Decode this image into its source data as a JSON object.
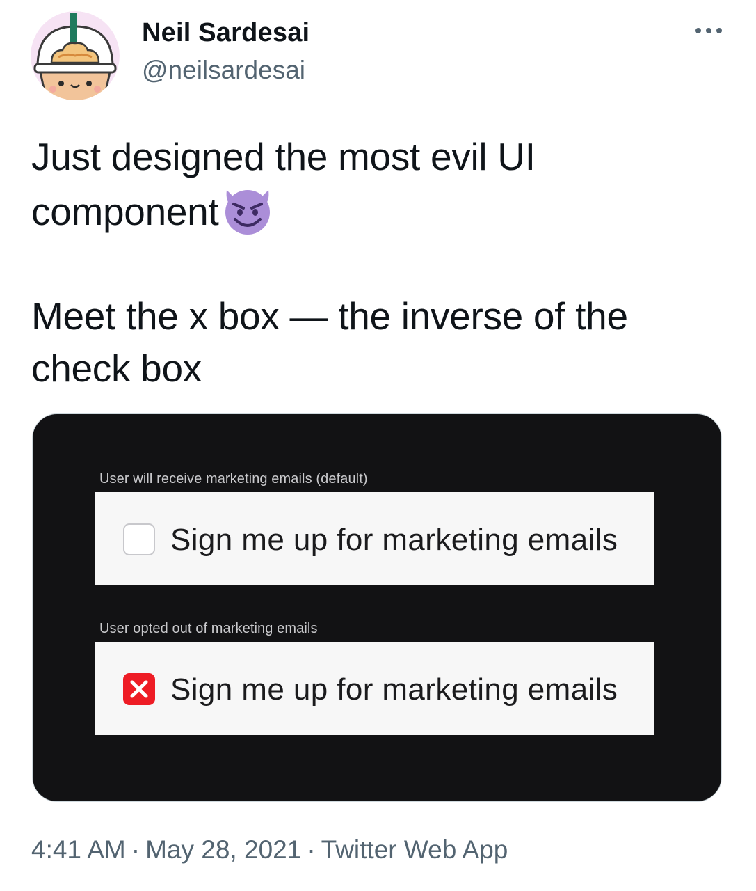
{
  "author": {
    "display_name": "Neil Sardesai",
    "handle": "@neilsardesai",
    "avatar_icon": "frappuccino-cup-avatar-icon"
  },
  "more_icon": "more-options-icon",
  "tweet": {
    "line1": "Just designed the most evil UI component",
    "emoji_icon": "smiling-devil-emoji-icon",
    "line2": "Meet the x box — the inverse of the check box"
  },
  "media": {
    "option1": {
      "caption": "User will receive marketing emails (default)",
      "label": "Sign me up for marketing emails",
      "state": "unchecked"
    },
    "option2": {
      "caption": "User opted out of marketing emails",
      "label": "Sign me up for marketing emails",
      "state": "x-marked"
    }
  },
  "meta": {
    "time": "4:41 AM",
    "date": "May 28, 2021",
    "source": "Twitter Web App",
    "separator": "·"
  },
  "colors": {
    "media_bg": "#121214",
    "x_box_red": "#ee1c25",
    "secondary_text": "#536471",
    "emoji_purple": "#ab8ed8"
  }
}
